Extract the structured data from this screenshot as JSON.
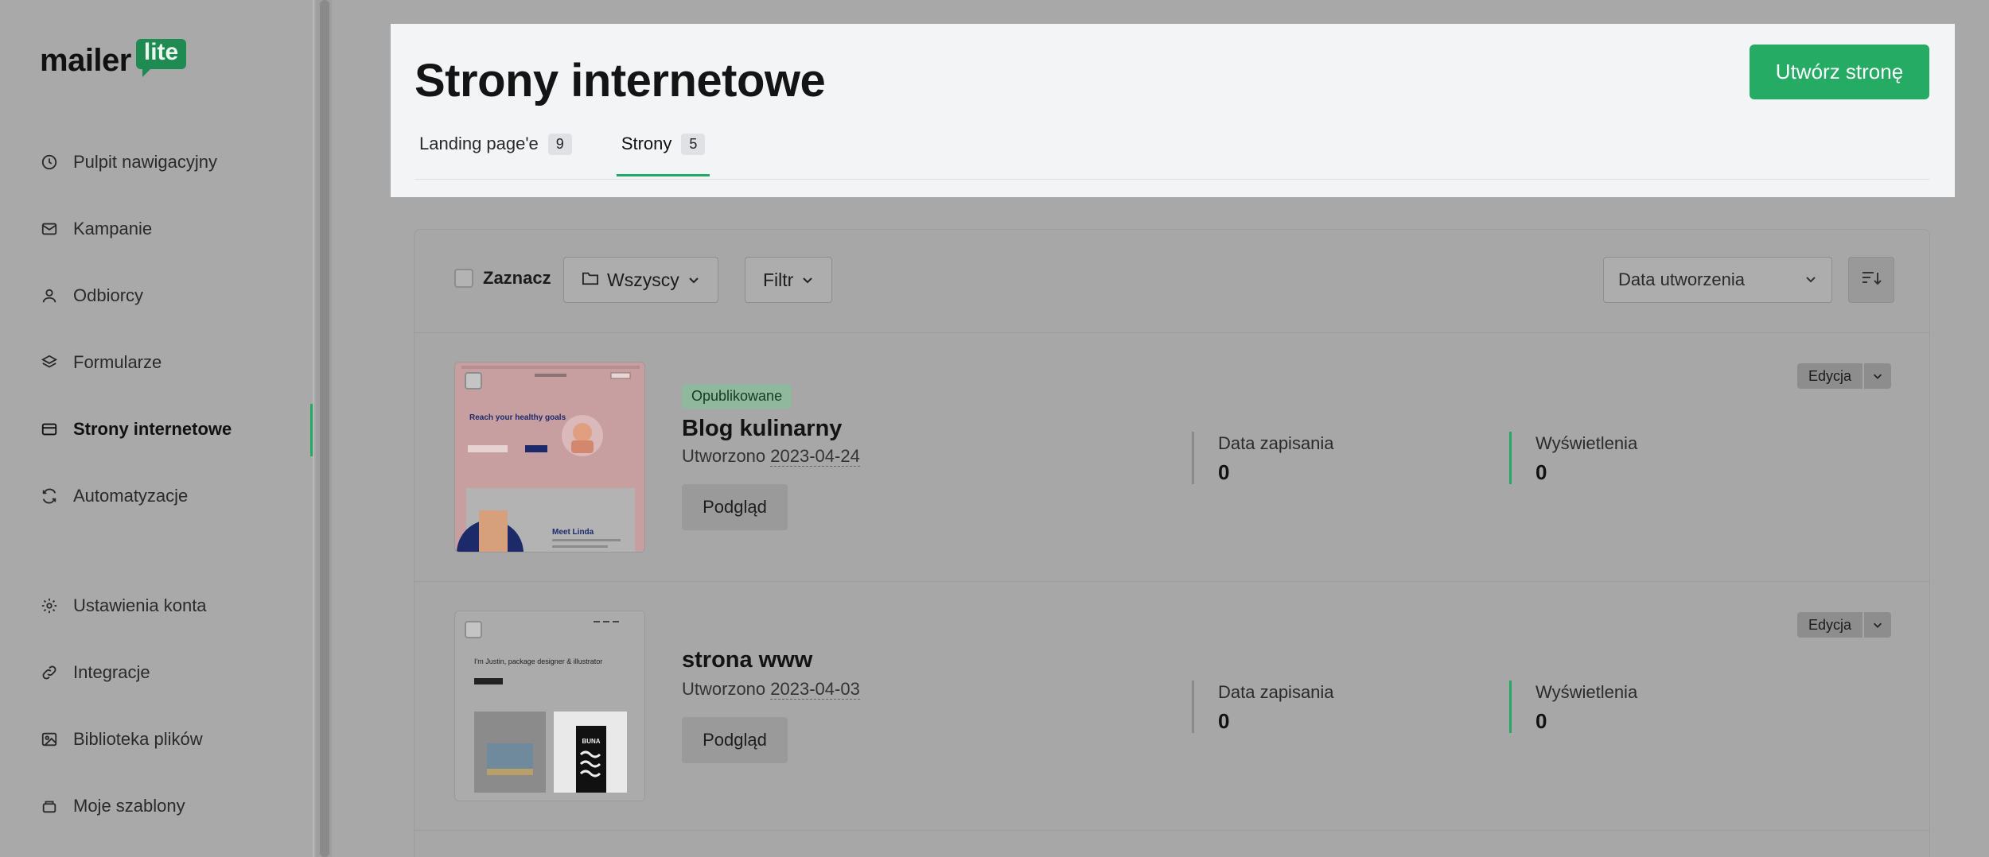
{
  "app": {
    "logo_word": "mailer",
    "logo_badge": "lite"
  },
  "sidebar": {
    "items": [
      {
        "label": "Pulpit nawigacyjny",
        "icon": "dashboard-icon"
      },
      {
        "label": "Kampanie",
        "icon": "envelope-icon"
      },
      {
        "label": "Odbiorcy",
        "icon": "user-icon"
      },
      {
        "label": "Formularze",
        "icon": "layers-icon"
      },
      {
        "label": "Strony internetowe",
        "icon": "browser-icon",
        "active": true
      },
      {
        "label": "Automatyzacje",
        "icon": "refresh-icon"
      },
      {
        "label": "Ustawienia konta",
        "icon": "gear-icon"
      },
      {
        "label": "Integracje",
        "icon": "link-icon"
      },
      {
        "label": "Biblioteka plików",
        "icon": "image-icon"
      },
      {
        "label": "Moje szablony",
        "icon": "template-icon"
      }
    ]
  },
  "header": {
    "title": "Strony internetowe",
    "create_button": "Utwórz stronę",
    "tabs": [
      {
        "label": "Landing page'e",
        "count": "9"
      },
      {
        "label": "Strony",
        "count": "5",
        "active": true
      }
    ]
  },
  "toolbar": {
    "select_all": "Zaznacz",
    "folder": "Wszyscy",
    "filter": "Filtr",
    "sort_by": "Data utworzenia"
  },
  "rows": [
    {
      "status": "Opublikowane",
      "title": "Blog kulinarny",
      "created_label": "Utworzono",
      "created_date": "2023-04-24",
      "preview": "Podgląd",
      "saved_label": "Data zapisania",
      "saved_value": "0",
      "views_label": "Wyświetlenia",
      "views_value": "0",
      "edit": "Edycja",
      "thumb_heading": "Reach your healthy goals",
      "thumb_sub": "Meet Linda"
    },
    {
      "title": "strona www",
      "created_label": "Utworzono",
      "created_date": "2023-04-03",
      "preview": "Podgląd",
      "saved_label": "Data zapisania",
      "saved_value": "0",
      "views_label": "Wyświetlenia",
      "views_value": "0",
      "edit": "Edycja",
      "thumb_heading": "I'm Justin, package designer & illustrator",
      "thumb_product": "BUNA"
    }
  ],
  "colors": {
    "accent": "#25ab63",
    "overlay": "#a8a8a8",
    "header_bg": "#f3f4f6"
  }
}
